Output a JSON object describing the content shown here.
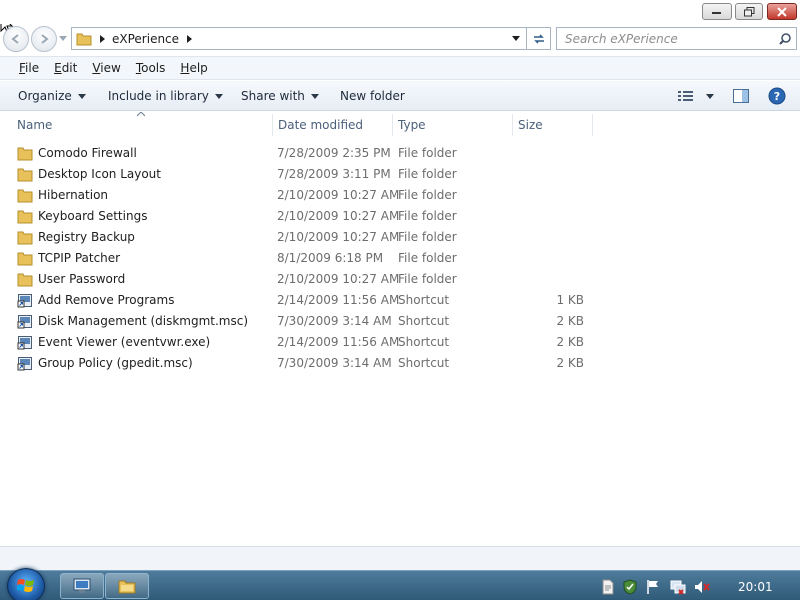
{
  "window": {
    "buttons": [
      "minimize",
      "maximize",
      "close"
    ]
  },
  "address": {
    "current_folder": "eXPerience",
    "search_placeholder": "Search eXPerience"
  },
  "menu": [
    {
      "label": "File",
      "accel": "F",
      "rest": "ile"
    },
    {
      "label": "Edit",
      "accel": "E",
      "rest": "dit"
    },
    {
      "label": "View",
      "accel": "V",
      "rest": "iew"
    },
    {
      "label": "Tools",
      "accel": "T",
      "rest": "ools"
    },
    {
      "label": "Help",
      "accel": "H",
      "rest": "elp"
    }
  ],
  "toolbar": {
    "organize": "Organize",
    "include_in_library": "Include in library",
    "share_with": "Share with",
    "new_folder": "New folder"
  },
  "columns": {
    "name": "Name",
    "date_modified": "Date modified",
    "type": "Type",
    "size": "Size"
  },
  "files": [
    {
      "name": "Comodo Firewall",
      "date": "7/28/2009 2:35 PM",
      "type": "File folder",
      "size": "",
      "icon": "folder-icon"
    },
    {
      "name": "Desktop Icon Layout",
      "date": "7/28/2009 3:11 PM",
      "type": "File folder",
      "size": "",
      "icon": "folder-icon"
    },
    {
      "name": "Hibernation",
      "date": "2/10/2009 10:27 AM",
      "type": "File folder",
      "size": "",
      "icon": "folder-icon"
    },
    {
      "name": "Keyboard Settings",
      "date": "2/10/2009 10:27 AM",
      "type": "File folder",
      "size": "",
      "icon": "folder-icon"
    },
    {
      "name": "Registry Backup",
      "date": "2/10/2009 10:27 AM",
      "type": "File folder",
      "size": "",
      "icon": "folder-icon"
    },
    {
      "name": "TCPIP Patcher",
      "date": "8/1/2009 6:18 PM",
      "type": "File folder",
      "size": "",
      "icon": "folder-icon"
    },
    {
      "name": "User Password",
      "date": "2/10/2009 10:27 AM",
      "type": "File folder",
      "size": "",
      "icon": "folder-icon"
    },
    {
      "name": "Add Remove Programs",
      "date": "2/14/2009 11:56 AM",
      "type": "Shortcut",
      "size": "1 KB",
      "icon": "shortcut-icon"
    },
    {
      "name": "Disk Management (diskmgmt.msc)",
      "date": "7/30/2009 3:14 AM",
      "type": "Shortcut",
      "size": "2 KB",
      "icon": "shortcut-icon"
    },
    {
      "name": "Event Viewer (eventvwr.exe)",
      "date": "2/14/2009 11:56 AM",
      "type": "Shortcut",
      "size": "2 KB",
      "icon": "shortcut-icon"
    },
    {
      "name": "Group Policy (gpedit.msc)",
      "date": "7/30/2009 3:14 AM",
      "type": "Shortcut",
      "size": "2 KB",
      "icon": "shortcut-icon"
    }
  ],
  "taskbar": {
    "clock": "20:01",
    "pinned": [
      "remote-desktop-icon",
      "explorer-folder-icon"
    ],
    "tray": [
      "document-icon",
      "security-shield-icon",
      "action-center-flag-icon",
      "network-icon",
      "volume-muted-icon"
    ]
  },
  "colors": {
    "taskbar": "#3a6585",
    "accent": "#1d5aa5",
    "folder": "#e8c15a",
    "close_button": "#c2372a"
  }
}
